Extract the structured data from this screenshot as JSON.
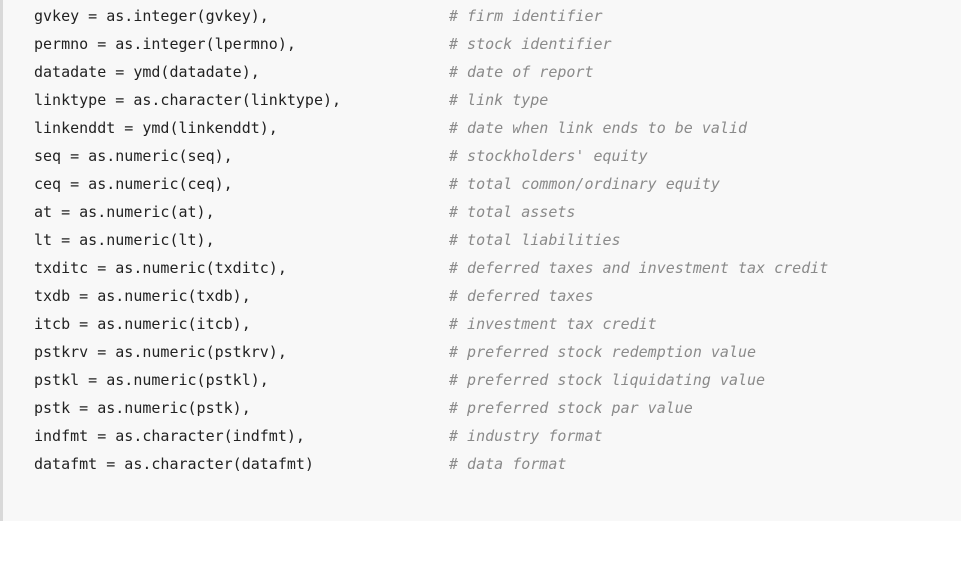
{
  "code": {
    "lines": [
      {
        "code": "gvkey = as.integer(gvkey),",
        "comment": "# firm identifier"
      },
      {
        "code": "permno = as.integer(lpermno),",
        "comment": "# stock identifier"
      },
      {
        "code": "datadate = ymd(datadate),",
        "comment": "# date of report"
      },
      {
        "code": "linktype = as.character(linktype),",
        "comment": "# link type"
      },
      {
        "code": "linkenddt = ymd(linkenddt),",
        "comment": "# date when link ends to be valid"
      },
      {
        "code": "seq = as.numeric(seq),",
        "comment": "# stockholders' equity"
      },
      {
        "code": "ceq = as.numeric(ceq),",
        "comment": "# total common/ordinary equity"
      },
      {
        "code": "at = as.numeric(at),",
        "comment": "# total assets"
      },
      {
        "code": "lt = as.numeric(lt),",
        "comment": "# total liabilities"
      },
      {
        "code": "txditc = as.numeric(txditc),",
        "comment": "# deferred taxes and investment tax credit"
      },
      {
        "code": "txdb = as.numeric(txdb),",
        "comment": "# deferred taxes"
      },
      {
        "code": "itcb = as.numeric(itcb),",
        "comment": "# investment tax credit"
      },
      {
        "code": "pstkrv = as.numeric(pstkrv),",
        "comment": "# preferred stock redemption value"
      },
      {
        "code": "pstkl = as.numeric(pstkl),",
        "comment": "# preferred stock liquidating value"
      },
      {
        "code": "pstk = as.numeric(pstk),",
        "comment": "# preferred stock par value"
      },
      {
        "code": "indfmt = as.character(indfmt),",
        "comment": "# industry format"
      },
      {
        "code": "datafmt = as.character(datafmt)",
        "comment": "# data format"
      }
    ]
  },
  "colors": {
    "background": "#f8f8f8",
    "border": "#d9d9d9",
    "code_text": "#222222",
    "comment_text": "#8a8a8a"
  }
}
